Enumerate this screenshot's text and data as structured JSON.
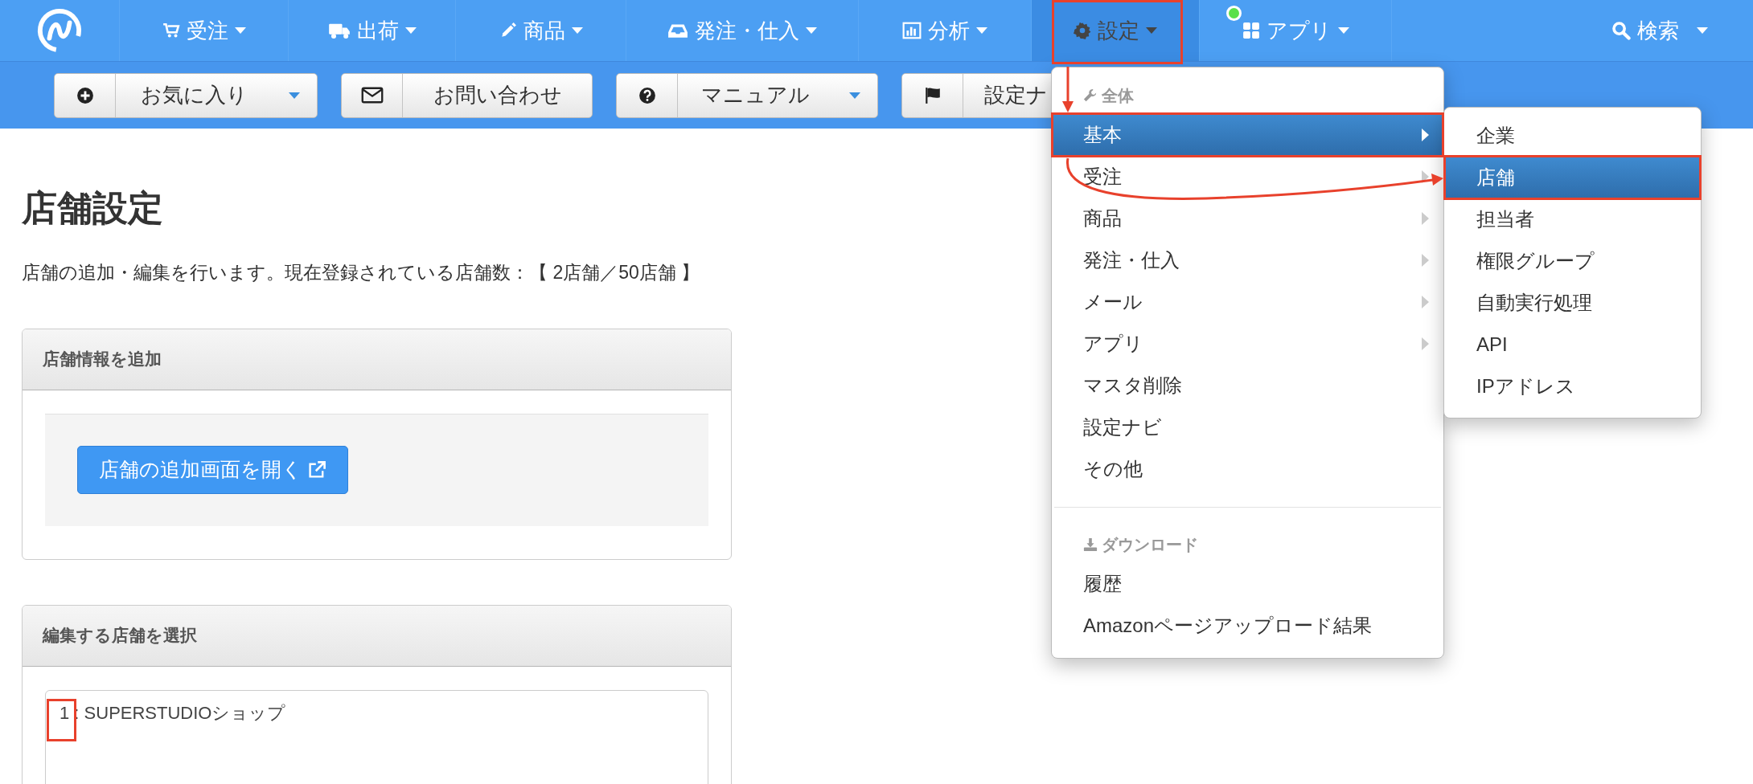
{
  "top_nav": {
    "items": [
      {
        "label": "受注",
        "selected": false,
        "notification": false
      },
      {
        "label": "出荷",
        "selected": false,
        "notification": false
      },
      {
        "label": "商品",
        "selected": false,
        "notification": false
      },
      {
        "label": "発注・仕入",
        "selected": false,
        "notification": false
      },
      {
        "label": "分析",
        "selected": false,
        "notification": false
      },
      {
        "label": "設定",
        "selected": true,
        "notification": false
      },
      {
        "label": "アプリ",
        "selected": false,
        "notification": true
      }
    ],
    "search": {
      "label": "検索"
    }
  },
  "toolbar": [
    {
      "label": "お気に入り",
      "dropdown": true
    },
    {
      "label": "お問い合わせ",
      "dropdown": false
    },
    {
      "label": "マニュアル",
      "dropdown": true
    },
    {
      "label": "設定ナ",
      "dropdown": false
    }
  ],
  "page": {
    "title": "店舗設定",
    "description": "店舗の追加・編集を行います。現在登録されている店舗数：【 2店舗／50店舗 】",
    "panels": [
      {
        "title": "店舗情報を追加",
        "button": "店舗の追加画面を開く"
      },
      {
        "title": "編集する店舗を選択",
        "options": [
          "1 : SUPERSTUDIOショップ"
        ]
      }
    ]
  },
  "settings_menu": {
    "sections": [
      {
        "header": "全体",
        "items": [
          {
            "label": "基本",
            "submenu": true,
            "selected": true
          },
          {
            "label": "受注",
            "submenu": true,
            "selected": false
          },
          {
            "label": "商品",
            "submenu": true,
            "selected": false
          },
          {
            "label": "発注・仕入",
            "submenu": true,
            "selected": false
          },
          {
            "label": "メール",
            "submenu": true,
            "selected": false
          },
          {
            "label": "アプリ",
            "submenu": true,
            "selected": false
          },
          {
            "label": "マスタ削除",
            "submenu": false,
            "selected": false
          },
          {
            "label": "設定ナビ",
            "submenu": false,
            "selected": false
          },
          {
            "label": "その他",
            "submenu": false,
            "selected": false
          }
        ]
      },
      {
        "header": "ダウンロード",
        "items": [
          {
            "label": "履歴",
            "submenu": false,
            "selected": false
          },
          {
            "label": "Amazonページアップロード結果",
            "submenu": false,
            "selected": false
          }
        ]
      }
    ]
  },
  "submenu": {
    "items": [
      {
        "label": "企業",
        "selected": false
      },
      {
        "label": "店舗",
        "selected": true
      },
      {
        "label": "担当者",
        "selected": false
      },
      {
        "label": "権限グループ",
        "selected": false
      },
      {
        "label": "自動実行処理",
        "selected": false
      },
      {
        "label": "API",
        "selected": false
      },
      {
        "label": "IPアドレス",
        "selected": false
      }
    ]
  }
}
